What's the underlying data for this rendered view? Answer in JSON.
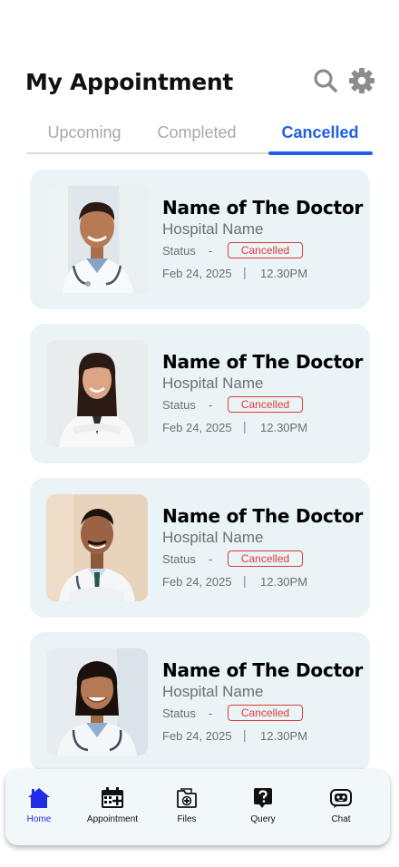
{
  "header": {
    "title": "My Appointment",
    "search_icon": "search-icon",
    "settings_icon": "gear-icon"
  },
  "tabs": [
    {
      "label": "Upcoming",
      "active": false
    },
    {
      "label": "Completed",
      "active": false
    },
    {
      "label": "Cancelled",
      "active": true
    }
  ],
  "appointments": [
    {
      "doctor": "Name of The Doctor",
      "hospital": "Hospital Name",
      "status_label": "Status",
      "dash": "-",
      "status": "Cancelled",
      "date": "Feb 24, 2025",
      "separator": "|",
      "time": "12.30PM"
    },
    {
      "doctor": "Name of The Doctor",
      "hospital": "Hospital Name",
      "status_label": "Status",
      "dash": "-",
      "status": "Cancelled",
      "date": "Feb 24, 2025",
      "separator": "|",
      "time": "12.30PM"
    },
    {
      "doctor": "Name of The Doctor",
      "hospital": "Hospital Name",
      "status_label": "Status",
      "dash": "-",
      "status": "Cancelled",
      "date": "Feb 24, 2025",
      "separator": "|",
      "time": "12.30PM"
    },
    {
      "doctor": "Name of The Doctor",
      "hospital": "Hospital Name",
      "status_label": "Status",
      "dash": "-",
      "status": "Cancelled",
      "date": "Feb 24, 2025",
      "separator": "|",
      "time": "12.30PM"
    }
  ],
  "nav": [
    {
      "label": "Home",
      "icon": "home-icon",
      "active": true
    },
    {
      "label": "Appointment",
      "icon": "calendar-add-icon",
      "active": false
    },
    {
      "label": "Files",
      "icon": "medical-folder-icon",
      "active": false
    },
    {
      "label": "Query",
      "icon": "question-bubble-icon",
      "active": false
    },
    {
      "label": "Chat",
      "icon": "chatbot-icon",
      "active": false
    }
  ],
  "colors": {
    "accent": "#1e5fe6",
    "nav_active": "#1f2ee6",
    "card_bg": "#eaf3f6",
    "cancelled": "#e03b3b",
    "nav_bg": "#f2f7f9"
  }
}
